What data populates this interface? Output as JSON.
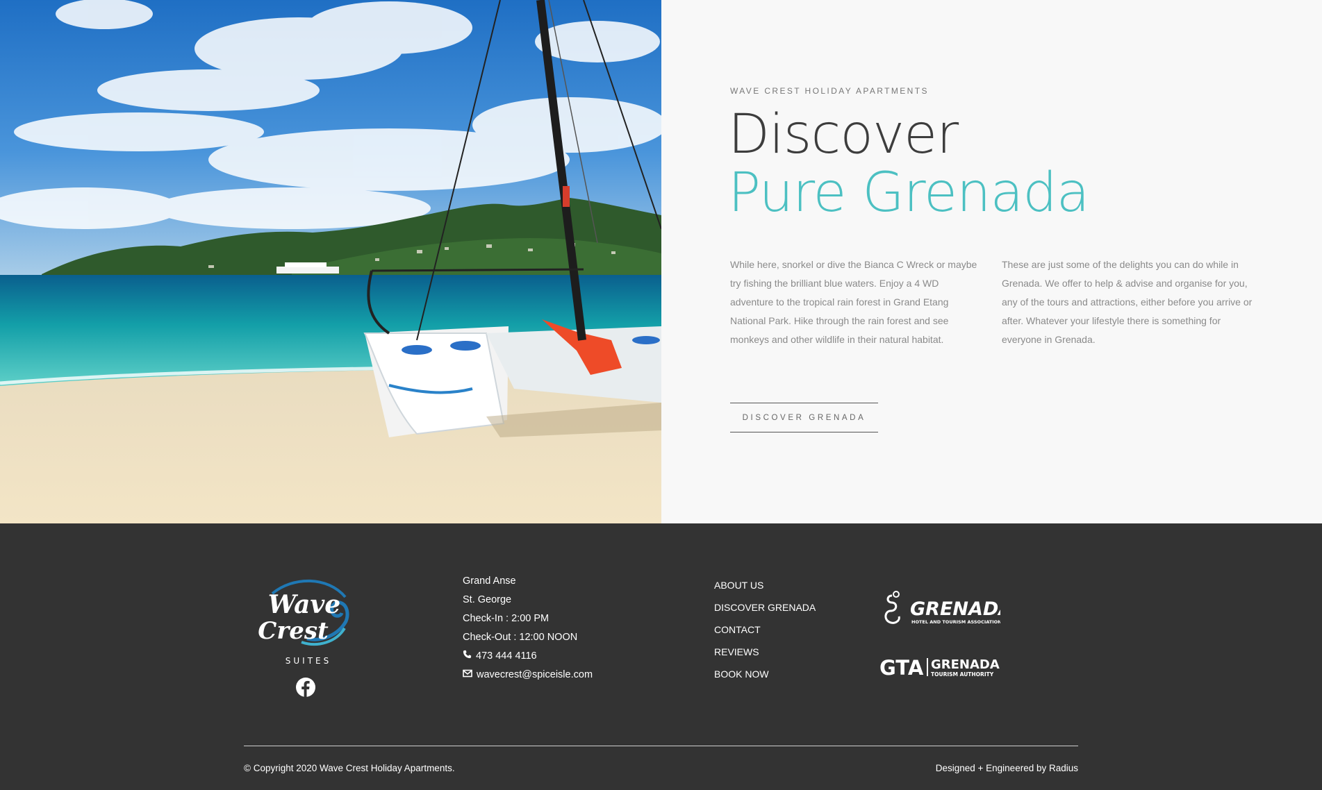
{
  "hero": {
    "image_alt": "Catamaran on Grand Anse beach with hills in the background",
    "eyebrow": "WAVE CREST HOLIDAY APARTMENTS",
    "title_line1": "Discover",
    "title_line2": "Pure Grenada",
    "paragraph_left": "While here, snorkel or dive the Bianca C Wreck or maybe try fishing the brilliant blue waters. Enjoy a 4 WD adventure to the tropical rain forest in Grand Etang National Park. Hike through the rain forest and see monkeys and other wildlife in their natural habitat.",
    "paragraph_right": "These are just some of the delights you can do while in Grenada. We offer to help & advise and organise for you, any of the tours and attractions, either before you arrive or after. Whatever your lifestyle there is something for everyone in Grenada.",
    "cta_label": "DISCOVER GRENADA",
    "title_accent_color": "#4cc0c2"
  },
  "footer": {
    "logo": {
      "line1": "Wave",
      "line2": "Crest",
      "subtitle": "SUITES"
    },
    "social_icon": "facebook-icon",
    "contact": {
      "address_line1": "Grand Anse",
      "address_line2": "St. George",
      "check_in": "Check-In : 2:00 PM",
      "check_out": "Check-Out : 12:00 NOON",
      "phone": "473 444 4116",
      "email": "wavecrest@spiceisle.com"
    },
    "nav": [
      "ABOUT US",
      "DISCOVER GRENADA",
      "CONTACT",
      "REVIEWS",
      "BOOK NOW"
    ],
    "partners": {
      "p1_name": "GRENADA",
      "p1_sub": "HOTEL AND TOURISM ASSOCIATION",
      "p2_abbr": "GTA",
      "p2_name": "GRENADA",
      "p2_sub": "TOURISM AUTHORITY"
    },
    "copyright": "© Copyright 2020 Wave Crest Holiday Apartments.",
    "credit": "Designed + Engineered by Radius",
    "background_color": "#333333"
  }
}
